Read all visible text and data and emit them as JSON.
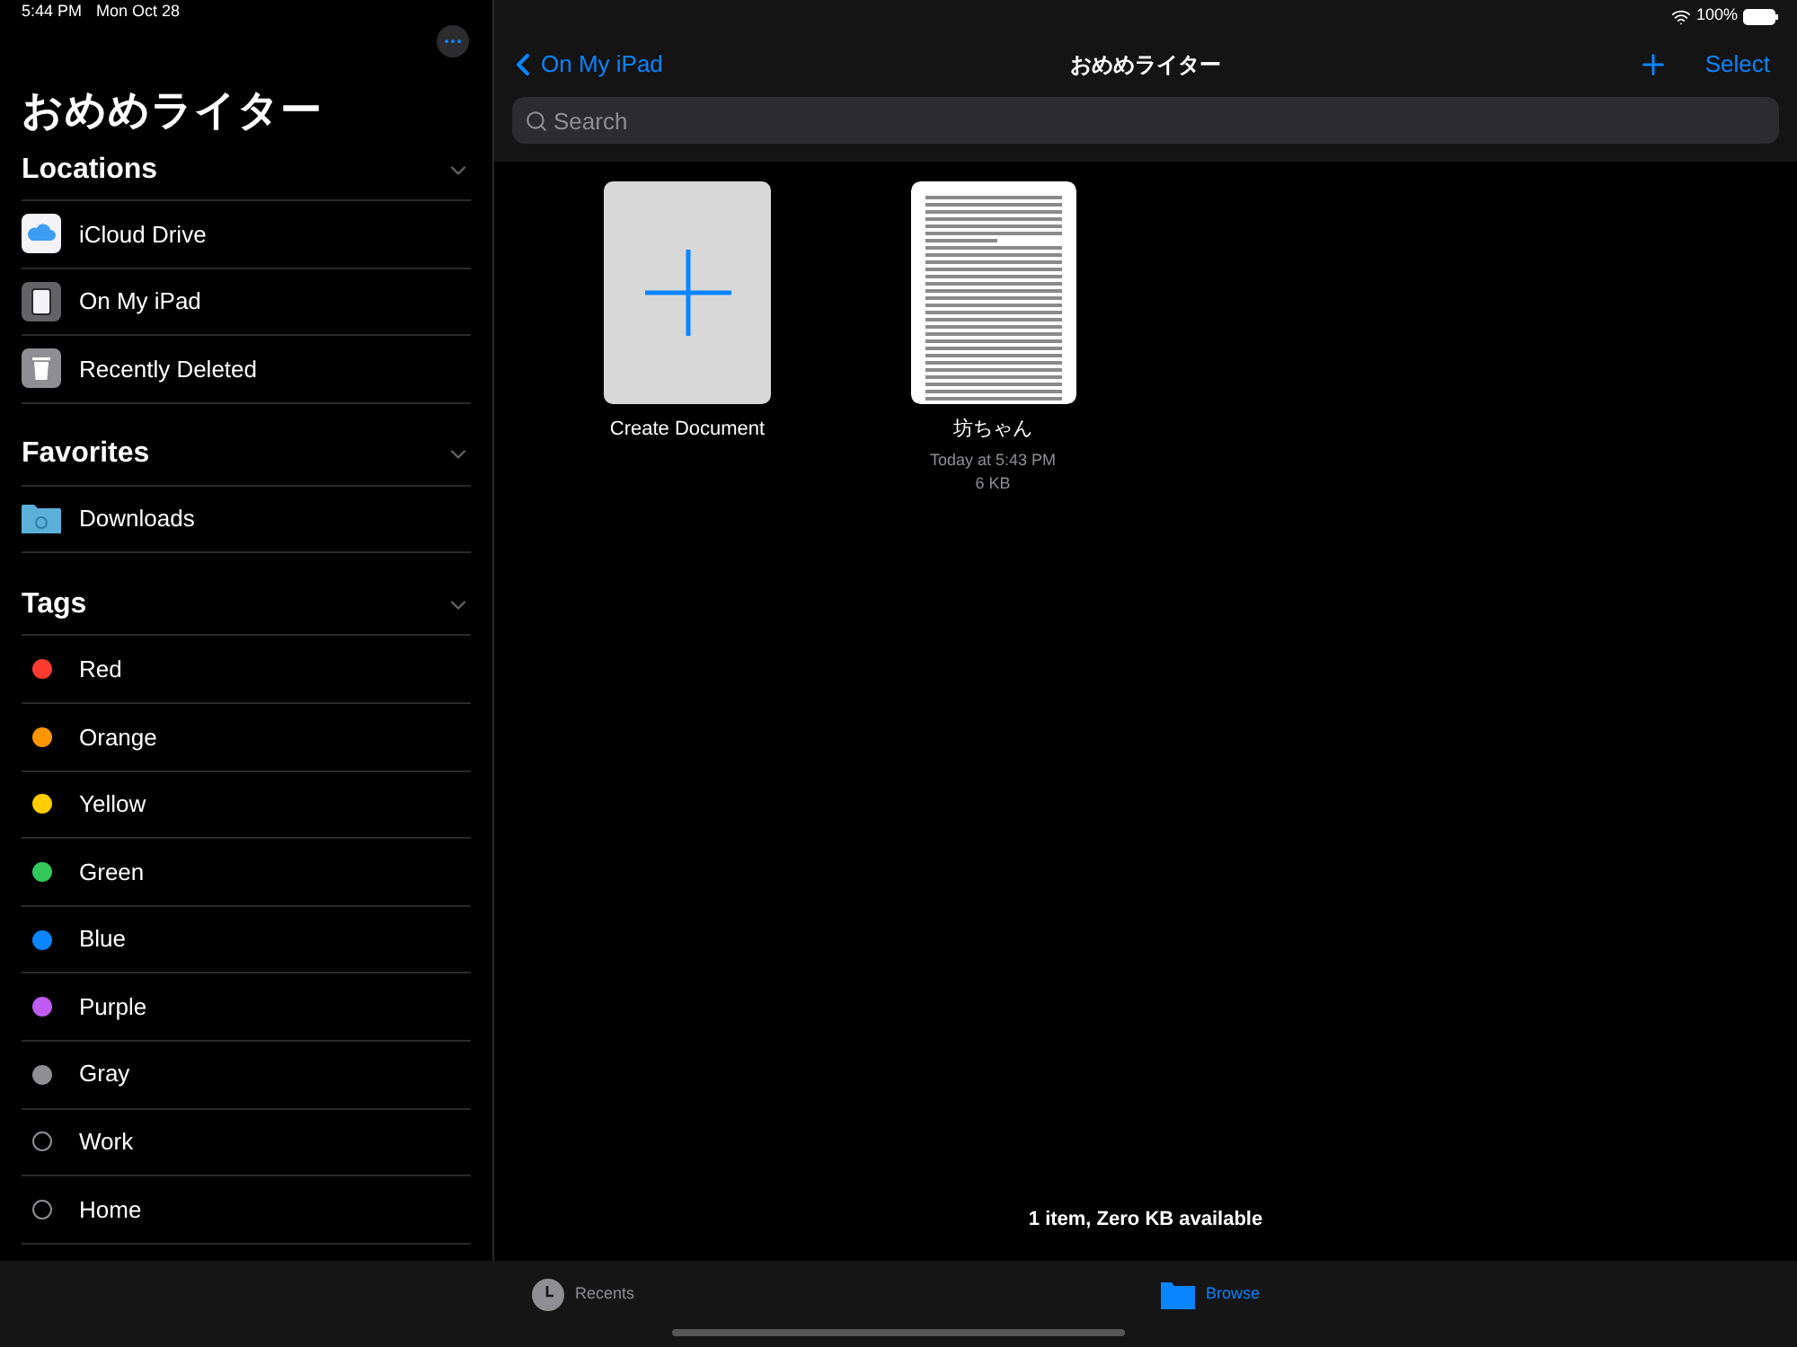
{
  "status_bar": {
    "time": "5:44 PM",
    "date": "Mon Oct 28",
    "battery": "100%"
  },
  "sidebar": {
    "title": "おめめライター",
    "sections": [
      {
        "title": "Locations",
        "expanded": true,
        "items": [
          {
            "label": "iCloud Drive",
            "kind": "cloud"
          },
          {
            "label": "On My iPad",
            "kind": "ipad"
          },
          {
            "label": "Recently Deleted",
            "kind": "trash"
          }
        ]
      },
      {
        "title": "Favorites",
        "expanded": true,
        "items": [
          {
            "label": "Downloads",
            "kind": "folder"
          }
        ]
      },
      {
        "title": "Tags",
        "expanded": true,
        "items": [
          {
            "label": "Red",
            "kind": "tag",
            "color": "#ff3b30"
          },
          {
            "label": "Orange",
            "kind": "tag",
            "color": "#ff9500"
          },
          {
            "label": "Yellow",
            "kind": "tag",
            "color": "#ffcc00"
          },
          {
            "label": "Green",
            "kind": "tag",
            "color": "#34c759"
          },
          {
            "label": "Blue",
            "kind": "tag",
            "color": "#0a84ff"
          },
          {
            "label": "Purple",
            "kind": "tag",
            "color": "#bf5af2"
          },
          {
            "label": "Gray",
            "kind": "tag",
            "color": "#8e8e93"
          },
          {
            "label": "Work",
            "kind": "tag"
          },
          {
            "label": "Home",
            "kind": "tag"
          }
        ]
      }
    ]
  },
  "nav": {
    "back": "On My iPad",
    "title": "おめめライター",
    "action": "Select"
  },
  "search": {
    "placeholder": "Search"
  },
  "items": [
    {
      "kind": "create",
      "name": "Create Document"
    },
    {
      "kind": "document",
      "name": "坊ちゃん",
      "date": "Today at 5:43 PM",
      "size": "6 KB"
    }
  ],
  "footer": "1 item, Zero KB available",
  "tabs": [
    {
      "label": "Recents",
      "kind": "clock",
      "selected": false
    },
    {
      "label": "Browse",
      "kind": "folder",
      "selected": true
    }
  ]
}
